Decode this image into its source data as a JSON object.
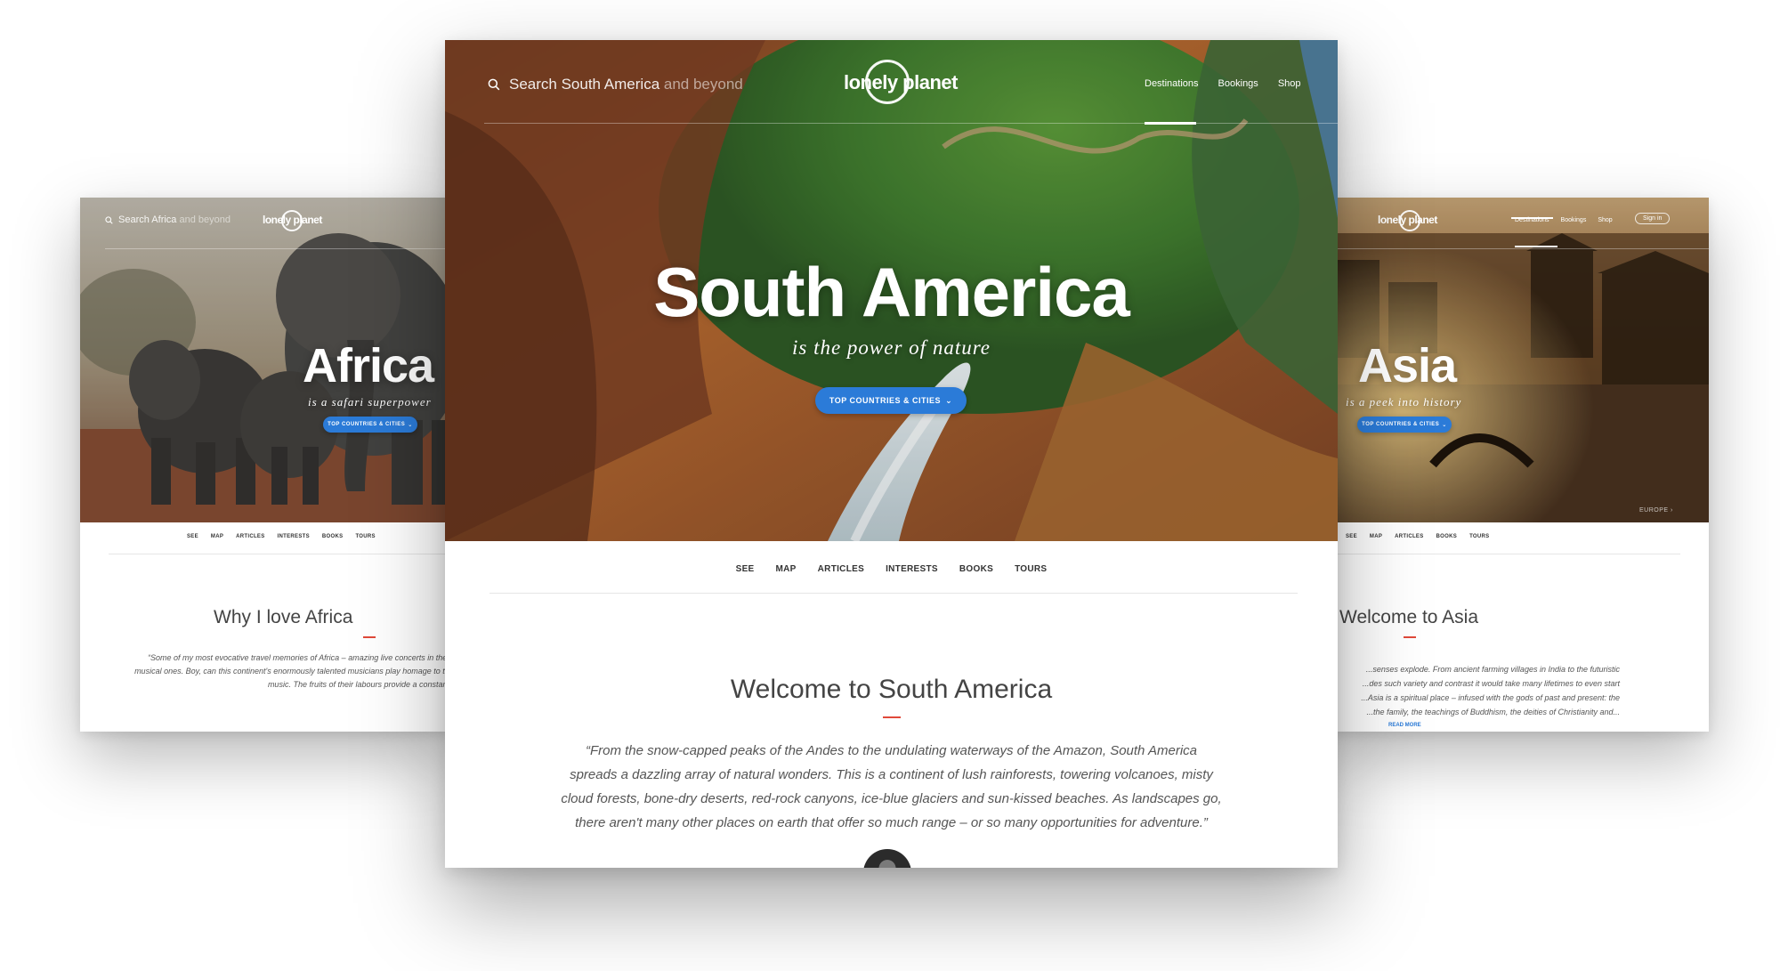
{
  "left_card": {
    "search": {
      "prefix": "Search Africa",
      "suffix": " and beyond"
    },
    "logo": "lonely planet",
    "hero_title": "Africa",
    "hero_subtitle": "is a safari superpower",
    "cta": "Top countries & cities",
    "subnav": [
      "SEE",
      "MAP",
      "ARTICLES",
      "INTERESTS",
      "BOOKS",
      "TOURS"
    ],
    "section_title": "Why I love Africa",
    "quote": "“Some of my most evocative travel memories of Africa – amazing live concerts in the mad circus of Marrakesh's Djemaa el-Fna – are musical ones. Boy, can this continent's enormously talented musicians play homage to the traditions of the past at the heart of contemporary music. The fruits of their labours provide a constant soundtrack..."
  },
  "main_card": {
    "search": {
      "prefix": "Search South America",
      "suffix": " and beyond"
    },
    "logo": "lonely planet",
    "nav": [
      "Destinations",
      "Bookings",
      "Shop"
    ],
    "hero_title": "South America",
    "hero_subtitle": "is the power of nature",
    "cta": "Top countries & cities",
    "subnav": [
      "SEE",
      "MAP",
      "ARTICLES",
      "INTERESTS",
      "BOOKS",
      "TOURS"
    ],
    "section_title": "Welcome to South America",
    "quote_lines": [
      "“From the snow-capped peaks of the Andes to the undulating waterways of the Amazon, South America",
      "spreads a dazzling array of natural wonders. This is a continent of lush rainforests, towering volcanoes, misty",
      "cloud forests, bone-dry deserts, red-rock canyons, ice-blue glaciers and sun-kissed beaches. As landscapes go,",
      "there aren't many other places on earth that offer so much range – or so many opportunities for adventure.”"
    ]
  },
  "right_card": {
    "logo": "lonely planet",
    "nav": [
      "Destinations",
      "Bookings",
      "Shop"
    ],
    "sign_in": "Sign in",
    "hero_title": "Asia",
    "hero_subtitle": "is a peek into history",
    "cta": "Top countries & cities",
    "region_label": "EUROPE",
    "subnav": [
      "SEE",
      "MAP",
      "ARTICLES",
      "BOOKS",
      "TOURS"
    ],
    "section_title": "Welcome to Asia",
    "quote_lines": [
      "...senses explode. From ancient farming villages in India to the futuristic",
      "...des such variety and contrast it would take many lifetimes to even start",
      "...Asia is a spiritual place – infused with the gods of past and present: the",
      "...the family, the teachings of Buddhism, the deities of Christianity and..."
    ],
    "read_more": "READ MORE"
  },
  "colors": {
    "accent_blue": "#2b7bd8",
    "rule_red": "#e0493a",
    "text_dark": "#444444"
  }
}
